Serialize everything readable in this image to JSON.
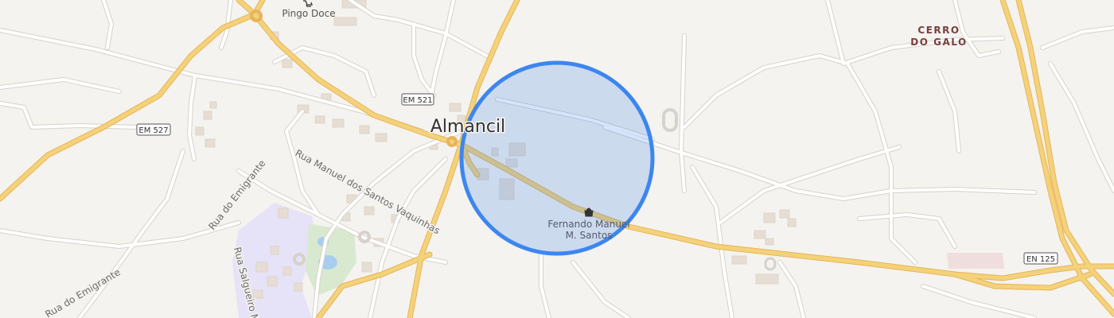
{
  "map": {
    "town_label": "Almancil",
    "district_label_line1": "CERRO",
    "district_label_line2": "DO GALO",
    "poi_supermarket": "Pingo Doce",
    "poi_shop_line1": "Fernando Manuel",
    "poi_shop_line2": "M. Santos",
    "road_shields": {
      "em521": "EM 521",
      "em527": "EM 527",
      "en125": "EN 125"
    },
    "street_labels": {
      "rua_manuel": "Rua Manuel dos Santos Vaquinhas",
      "rua_emigrante_1": "Rua do Emigrante",
      "rua_emigrante_2": "Rua do Emigrante",
      "rua_salgueiro": "Rua Salgueiro M"
    },
    "colors": {
      "background": "#f5f3ef",
      "major_road": "#f4d27a",
      "major_road_casing": "#e7b45a",
      "minor_road": "#ffffff",
      "minor_road_casing": "#d6d2cb",
      "radius_fill": "#c7d9f4",
      "radius_stroke": "#3d86ef",
      "park": "#d8e9cf",
      "school_area": "#e6e2f7",
      "building": "#e6ded4",
      "district_text": "#7a3e3e",
      "street_text": "#6b6b6b"
    }
  }
}
